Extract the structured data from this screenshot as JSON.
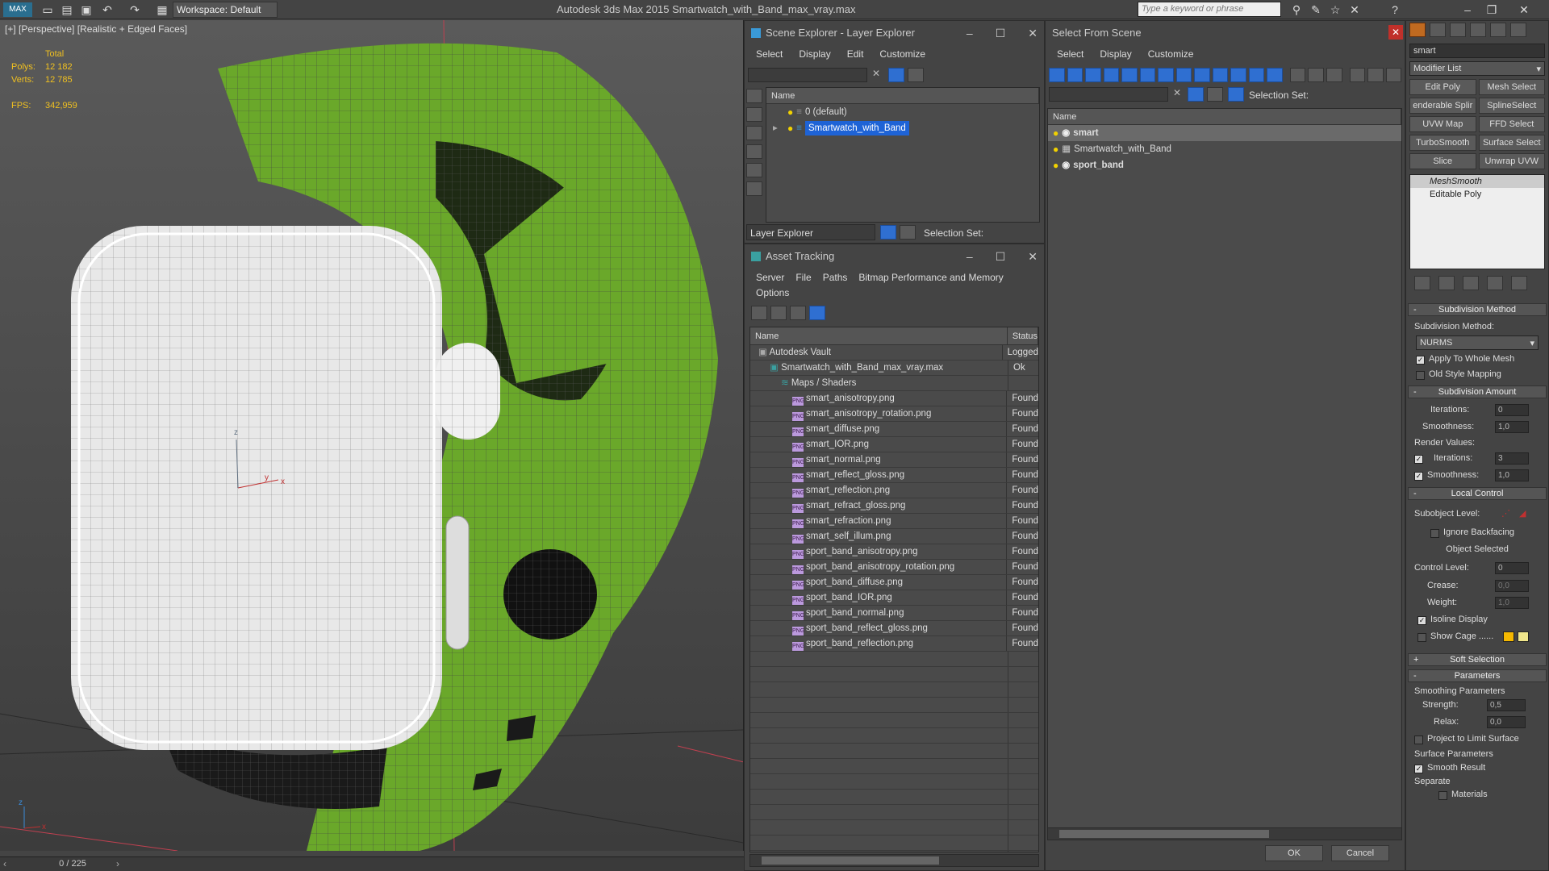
{
  "titlebar": {
    "logo": "MAX",
    "workspace": "Workspace: Default",
    "app_title": "Autodesk 3ds Max  2015     Smartwatch_with_Band_max_vray.max",
    "search_placeholder": "Type a keyword or phrase"
  },
  "viewport": {
    "label": "[+] [Perspective] [Realistic + Edged Faces]",
    "stats": {
      "total_label": "Total",
      "polys_label": "Polys:",
      "polys": "12 182",
      "verts_label": "Verts:",
      "verts": "12 785",
      "fps_label": "FPS:",
      "fps": "342,959"
    },
    "axes": {
      "x": "x",
      "y": "y",
      "z": "z"
    }
  },
  "timeline": {
    "frame": "0 / 225"
  },
  "scene_explorer": {
    "title": "Scene Explorer - Layer Explorer",
    "menu": [
      "Select",
      "Display",
      "Edit",
      "Customize"
    ],
    "column_name": "Name",
    "rows": [
      "0 (default)",
      "Smartwatch_with_Band"
    ],
    "footer_dropdown": "Layer Explorer",
    "selection_set": "Selection Set:"
  },
  "asset_tracking": {
    "title": "Asset Tracking",
    "menu": [
      "Server",
      "File",
      "Paths",
      "Bitmap Performance and Memory",
      "Options"
    ],
    "col_name": "Name",
    "col_status": "Status",
    "rows": [
      {
        "name": "Autodesk Vault",
        "status": "Logged",
        "indent": 0
      },
      {
        "name": "Smartwatch_with_Band_max_vray.max",
        "status": "Ok",
        "indent": 1
      },
      {
        "name": "Maps / Shaders",
        "status": "",
        "indent": 2
      },
      {
        "name": "smart_anisotropy.png",
        "status": "Found",
        "indent": 3
      },
      {
        "name": "smart_anisotropy_rotation.png",
        "status": "Found",
        "indent": 3
      },
      {
        "name": "smart_diffuse.png",
        "status": "Found",
        "indent": 3
      },
      {
        "name": "smart_IOR.png",
        "status": "Found",
        "indent": 3
      },
      {
        "name": "smart_normal.png",
        "status": "Found",
        "indent": 3
      },
      {
        "name": "smart_reflect_gloss.png",
        "status": "Found",
        "indent": 3
      },
      {
        "name": "smart_reflection.png",
        "status": "Found",
        "indent": 3
      },
      {
        "name": "smart_refract_gloss.png",
        "status": "Found",
        "indent": 3
      },
      {
        "name": "smart_refraction.png",
        "status": "Found",
        "indent": 3
      },
      {
        "name": "smart_self_illum.png",
        "status": "Found",
        "indent": 3
      },
      {
        "name": "sport_band_anisotropy.png",
        "status": "Found",
        "indent": 3
      },
      {
        "name": "sport_band_anisotropy_rotation.png",
        "status": "Found",
        "indent": 3
      },
      {
        "name": "sport_band_diffuse.png",
        "status": "Found",
        "indent": 3
      },
      {
        "name": "sport_band_IOR.png",
        "status": "Found",
        "indent": 3
      },
      {
        "name": "sport_band_normal.png",
        "status": "Found",
        "indent": 3
      },
      {
        "name": "sport_band_reflect_gloss.png",
        "status": "Found",
        "indent": 3
      },
      {
        "name": "sport_band_reflection.png",
        "status": "Found",
        "indent": 3
      }
    ]
  },
  "select_from_scene": {
    "title": "Select From Scene",
    "menu": [
      "Select",
      "Display",
      "Customize"
    ],
    "selection_set": "Selection Set:",
    "column_name": "Name",
    "rows": [
      "smart",
      "Smartwatch_with_Band",
      "sport_band"
    ],
    "ok": "OK",
    "cancel": "Cancel"
  },
  "command_panel": {
    "object_name": "smart",
    "modifier_list": "Modifier List",
    "buttons": [
      "Edit Poly",
      "Mesh Select",
      "enderable Splir",
      "SplineSelect",
      "UVW Map",
      "FFD Select",
      "TurboSmooth",
      "Surface Select",
      "Slice",
      "Unwrap UVW"
    ],
    "stack": [
      "MeshSmooth",
      "Editable Poly"
    ],
    "subdivision_method_header": "Subdivision Method",
    "subdivision_method_label": "Subdivision Method:",
    "subdivision_method_value": "NURMS",
    "apply_whole_mesh": "Apply To Whole Mesh",
    "old_style_mapping": "Old Style Mapping",
    "subdivision_amount_header": "Subdivision Amount",
    "iterations_label": "Iterations:",
    "iterations": "0",
    "smoothness_label": "Smoothness:",
    "smoothness": "1,0",
    "render_values": "Render Values:",
    "render_iterations_label": "Iterations:",
    "render_iterations": "3",
    "render_smoothness_label": "Smoothness:",
    "render_smoothness": "1,0",
    "local_control_header": "Local Control",
    "subobject_level": "Subobject Level:",
    "ignore_backfacing": "Ignore Backfacing",
    "object_selected": "Object Selected",
    "control_level_label": "Control Level:",
    "control_level": "0",
    "crease_label": "Crease:",
    "crease": "0,0",
    "weight_label": "Weight:",
    "weight": "1,0",
    "isoline_display": "Isoline Display",
    "show_cage": "Show Cage ......",
    "cage_color_1": "#f5b800",
    "cage_color_2": "#f0e68c",
    "soft_selection_header": "Soft Selection",
    "parameters_header": "Parameters",
    "smoothing_parameters": "Smoothing Parameters",
    "strength_label": "Strength:",
    "strength": "0,5",
    "relax_label": "Relax:",
    "relax": "0,0",
    "project_limit": "Project to Limit Surface",
    "surface_parameters": "Surface Parameters",
    "smooth_result": "Smooth Result",
    "separate": "Separate",
    "materials": "Materials"
  },
  "colors": {
    "band_green": "#6aa82a",
    "selection_blue": "#1e63d6",
    "stat_yellow": "#f0c020"
  }
}
